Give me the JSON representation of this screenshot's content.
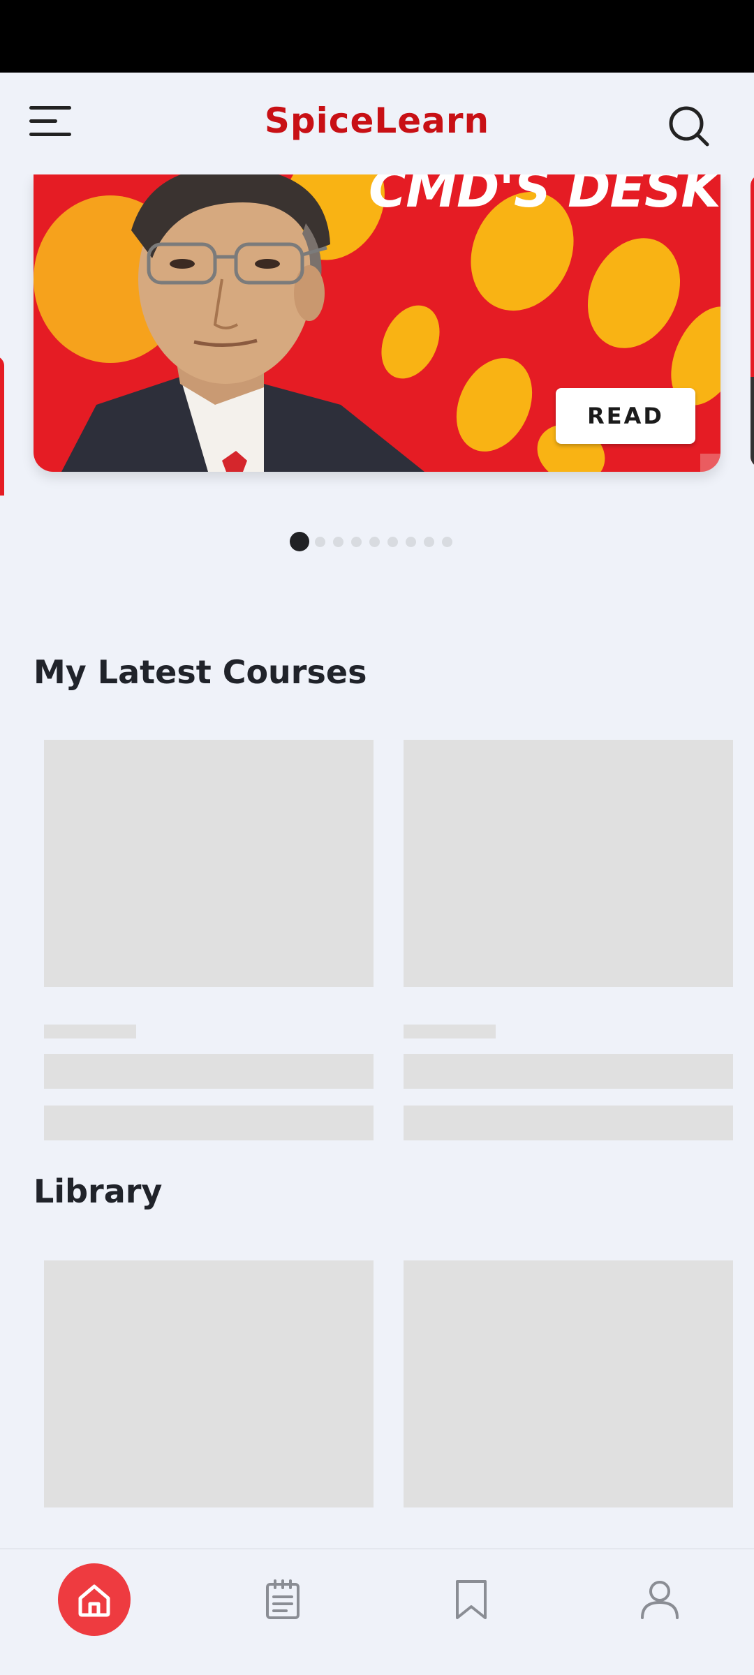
{
  "header": {
    "app_title": "SpiceLearn",
    "menu_icon": "menu-icon",
    "search_icon": "search-icon"
  },
  "carousel": {
    "slides_total": 9,
    "active_slide": 1,
    "banner": {
      "heading": "CMD'S DESK",
      "button_label": "READ"
    }
  },
  "sections": {
    "latest_courses": {
      "title": "My Latest Courses"
    },
    "library": {
      "title": "Library"
    }
  },
  "bottom_nav": {
    "items": [
      {
        "id": "home",
        "icon": "home-icon",
        "active": true
      },
      {
        "id": "notes",
        "icon": "notepad-icon",
        "active": false
      },
      {
        "id": "bookmarks",
        "icon": "bookmark-icon",
        "active": false
      },
      {
        "id": "profile",
        "icon": "user-icon",
        "active": false
      }
    ]
  },
  "colors": {
    "brand_red": "#c81015",
    "active_nav": "#ee3b40",
    "background": "#eff2f9",
    "skeleton": "#e0e0e0"
  }
}
